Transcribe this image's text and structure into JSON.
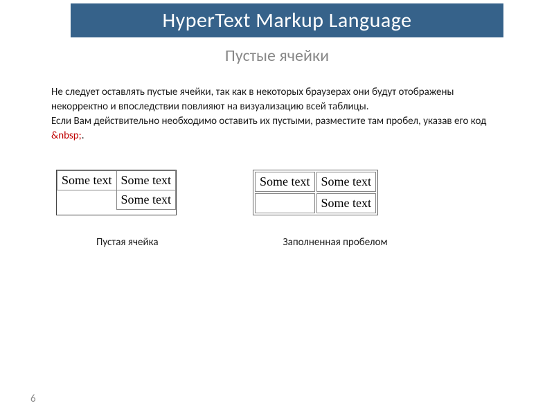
{
  "header": {
    "title": "HyperText Markup Language"
  },
  "subtitle": "Пустые ячейки",
  "body": {
    "paragraph1": "Не следует оставлять пустые ячейки, так как в некоторых браузерах они будут отображены некорректно и впоследствии повлияют на визуализацию всей таблицы.",
    "paragraph2_pre": "Если Вам действительно необходимо оставить их пустыми, разместите там пробел, указав его код ",
    "paragraph2_code": "&nbsp;",
    "paragraph2_post": "."
  },
  "tables": {
    "left": {
      "rows": [
        [
          "Some text",
          "Some text"
        ],
        [
          "",
          "Some text"
        ]
      ]
    },
    "right": {
      "rows": [
        [
          "Some text",
          "Some text"
        ],
        [
          " ",
          "Some text"
        ]
      ]
    }
  },
  "labels": {
    "left": "Пустая ячейка",
    "right": "Заполненная пробелом"
  },
  "page_number": "6"
}
